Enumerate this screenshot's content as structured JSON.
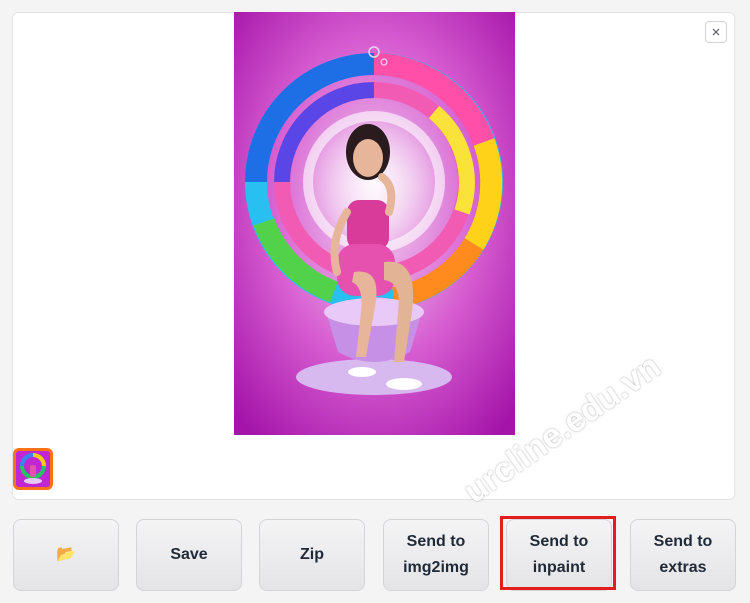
{
  "gallery": {
    "close_label": "×",
    "image_description": "generated image",
    "accent_thumb_border": "#f97316"
  },
  "actions": {
    "folder_icon": "📂",
    "save_label": "Save",
    "zip_label": "Zip",
    "img2img_label": "Send to\nimg2img",
    "inpaint_label": "Send to\ninpaint",
    "extras_label": "Send to\nextras"
  },
  "highlight_color": "#e11d1d",
  "watermark": "urcline.edu.vn"
}
